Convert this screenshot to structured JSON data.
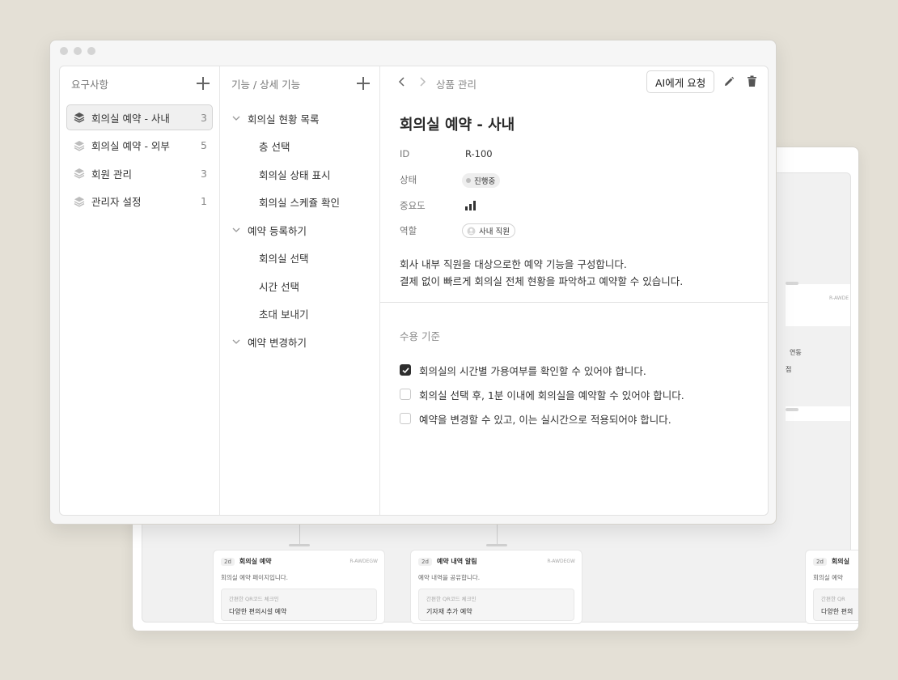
{
  "requirements": {
    "title": "요구사항",
    "items": [
      {
        "label": "회의실 예약 - 사내",
        "count": "3",
        "selected": true
      },
      {
        "label": "회의실 예약 - 외부",
        "count": "5",
        "selected": false
      },
      {
        "label": "회원 관리",
        "count": "3",
        "selected": false
      },
      {
        "label": "관리자 설정",
        "count": "1",
        "selected": false
      }
    ]
  },
  "features": {
    "title": "기능 / 상세 기능",
    "groups": [
      {
        "label": "회의실 현황 목록",
        "children": [
          "층 선택",
          "회의실 상태 표시",
          "회의실 스케쥴 확인"
        ]
      },
      {
        "label": "예약 등록하기",
        "children": [
          "회의실 선택",
          "시간 선택",
          "초대 보내기"
        ]
      },
      {
        "label": "예약 변경하기",
        "children": []
      }
    ]
  },
  "detail": {
    "breadcrumb": "상품 관리",
    "ai_button": "AI에게 요청",
    "title": "회의실 예약 - 사내",
    "props": {
      "id_label": "ID",
      "id_value": "R-100",
      "status_label": "상태",
      "status_value": "진행중",
      "priority_label": "중요도",
      "role_label": "역할",
      "role_value": "사내 직원"
    },
    "description_lines": [
      "회사 내부 직원을 대상으로한 예약 기능을 구성합니다.",
      "결제 없이 빠르게 회의실 전체 현황을 파악하고 예약할 수 있습니다."
    ],
    "acceptance_title": "수용 기준",
    "criteria": [
      {
        "text": "회의실의 시간별 가용여부를 확인할 수 있어야 합니다.",
        "checked": true
      },
      {
        "text": "회의실 선택 후, 1분 이내에 회의실을 예약할 수 있어야 합니다.",
        "checked": false
      },
      {
        "text": "예약을 변경할 수 있고, 이는 실시간으로 적용되어야 합니다.",
        "checked": false
      }
    ]
  },
  "background": {
    "fragments": {
      "code": "R-AWDE",
      "text1": "연동",
      "text2": "점"
    },
    "cards": [
      {
        "badge": "2d",
        "title": "회의실 예약",
        "code": "R-AWDEGW",
        "desc": "회의실 예약 페이지입니다.",
        "inner_label": "간편한 QR코드 체크인",
        "inner_text": "다양한 편의시설 예약"
      },
      {
        "badge": "2d",
        "title": "예약 내역 알림",
        "code": "R-AWDEGW",
        "desc": "예약 내역을 공유합니다.",
        "inner_label": "간편한 QR코드 체크인",
        "inner_text": "기자재 추가 예약"
      },
      {
        "badge": "2d",
        "title": "회의실",
        "code": "",
        "desc": "회의실 예약",
        "inner_label": "간편한 QR",
        "inner_text": "다양한 편의"
      }
    ]
  },
  "colors": {
    "background": "#e4e0d6",
    "checked": "#2e2e2e",
    "border": "#d4d4d4"
  }
}
